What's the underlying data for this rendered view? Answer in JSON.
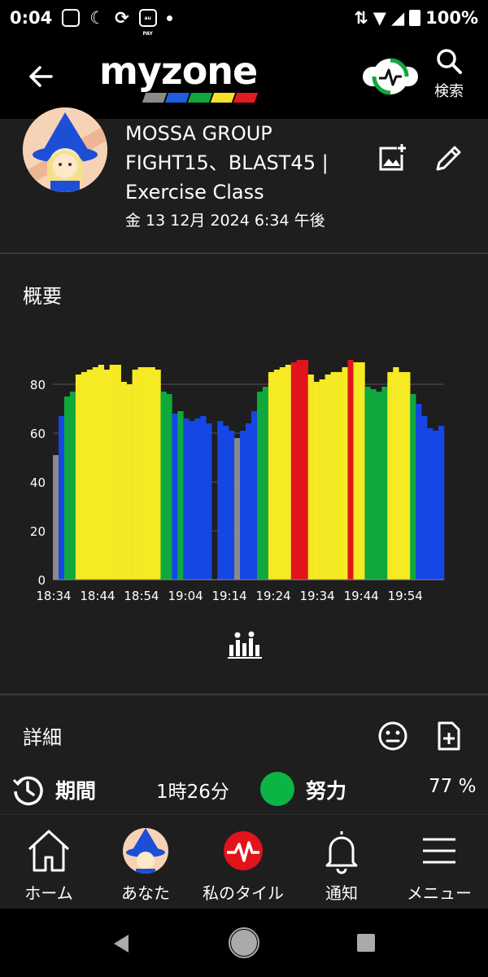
{
  "status_bar": {
    "time": "0:04",
    "battery": "100%",
    "pay_label": "au PAY"
  },
  "app_bar": {
    "logo_text": "myzone",
    "search_label": "検索",
    "brand_colors": [
      "#8a8a8a",
      "#1f5ee0",
      "#10a83c",
      "#f5e12a",
      "#e11b22"
    ]
  },
  "header": {
    "title": "MOSSA GROUP FIGHT15、BLAST45 | Exercise Class",
    "title_lines": [
      "MOSSA GROUP",
      "FIGHT15、BLAST45 |",
      "Exercise Class"
    ],
    "date": "金 13 12月 2024 6:34 午後"
  },
  "overview": {
    "title": "概要"
  },
  "chart_data": {
    "type": "bar",
    "title": "",
    "xlabel": "",
    "ylabel": "",
    "ylim": [
      0,
      100
    ],
    "yticks": [
      0,
      20,
      40,
      60,
      80
    ],
    "xticks": [
      "18:34",
      "18:44",
      "18:54",
      "19:04",
      "19:14",
      "19:24",
      "19:34",
      "19:44",
      "19:54"
    ],
    "zone_colors": {
      "gray": "#8a8a8a",
      "blue": "#1547e6",
      "green": "#0fa83c",
      "yellow": "#f6ea24",
      "red": "#e0141a"
    },
    "values": [
      51,
      67,
      75,
      77,
      84,
      85,
      86,
      87,
      88,
      86,
      88,
      88,
      81,
      80,
      86,
      87,
      87,
      87,
      86,
      77,
      76,
      68,
      69,
      66,
      65,
      66,
      67,
      64,
      60,
      65,
      63,
      61,
      58,
      61,
      64,
      69,
      77,
      79,
      85,
      86,
      87,
      88,
      89,
      90,
      90,
      84,
      81,
      82,
      84,
      85,
      85,
      87,
      90,
      89,
      89,
      79,
      78,
      77,
      79,
      85,
      87,
      85,
      85,
      76,
      72,
      67,
      62,
      61,
      63
    ],
    "zones": [
      "gray",
      "blue",
      "green",
      "green",
      "yellow",
      "yellow",
      "yellow",
      "yellow",
      "yellow",
      "yellow",
      "yellow",
      "yellow",
      "yellow",
      "yellow",
      "yellow",
      "yellow",
      "yellow",
      "yellow",
      "yellow",
      "green",
      "green",
      "blue",
      "green",
      "blue",
      "blue",
      "blue",
      "blue",
      "blue",
      "none",
      "blue",
      "blue",
      "blue",
      "gray",
      "blue",
      "blue",
      "blue",
      "green",
      "green",
      "yellow",
      "yellow",
      "yellow",
      "yellow",
      "red",
      "red",
      "red",
      "yellow",
      "yellow",
      "yellow",
      "yellow",
      "yellow",
      "yellow",
      "yellow",
      "red",
      "yellow",
      "yellow",
      "green",
      "green",
      "green",
      "green",
      "yellow",
      "yellow",
      "yellow",
      "yellow",
      "green",
      "blue",
      "blue",
      "blue",
      "blue",
      "blue"
    ]
  },
  "details": {
    "title": "詳細",
    "duration_label": "期間",
    "duration_value": "1時26分",
    "effort_label": "努力",
    "effort_value": "77 %"
  },
  "nav": {
    "home": "ホーム",
    "you": "あなた",
    "my_tiles": "私のタイル",
    "notifications": "通知",
    "menu": "メニュー"
  }
}
